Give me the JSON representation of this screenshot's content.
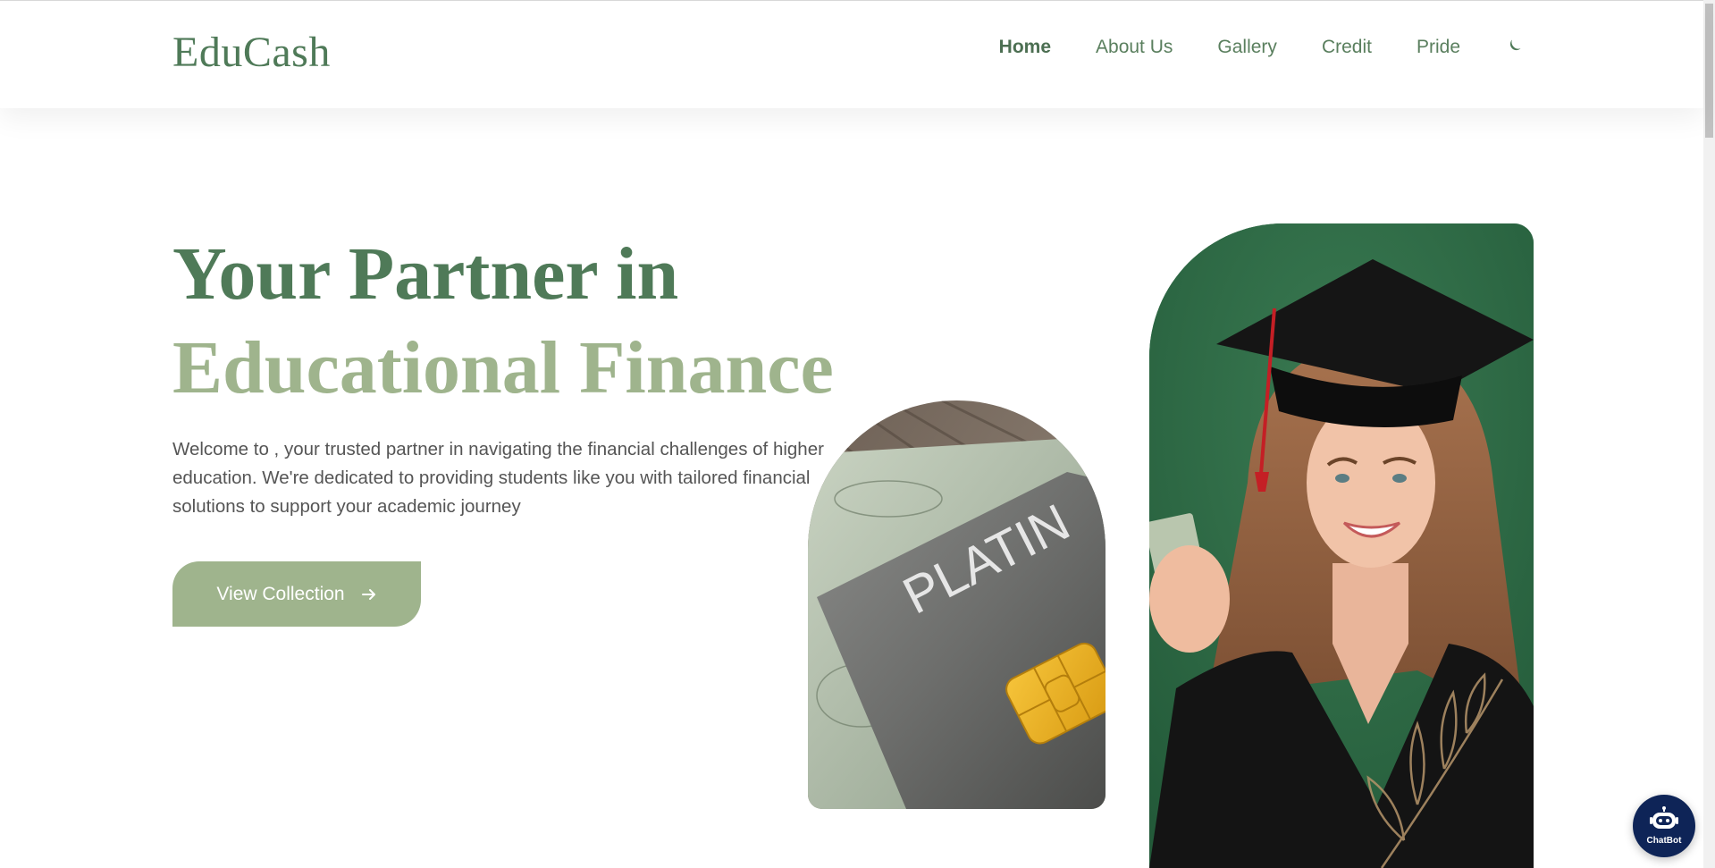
{
  "brand": {
    "name": "EduCash"
  },
  "nav": {
    "items": [
      {
        "label": "Home",
        "active": true
      },
      {
        "label": "About Us",
        "active": false
      },
      {
        "label": "Gallery",
        "active": false
      },
      {
        "label": "Credit",
        "active": false
      },
      {
        "label": "Pride",
        "active": false
      }
    ],
    "theme_toggle_icon": "moon-icon"
  },
  "hero": {
    "title_line1": "Your Partner in",
    "title_line2": "Educational Finance",
    "intro": "Welcome to , your trusted partner in navigating the financial challenges of higher education. We're dedicated to providing students like you with tailored financial solutions to support your academic journey",
    "cta_label": "View Collection",
    "cta_icon": "arrow-right-icon"
  },
  "images": {
    "card_text": "PLATIN",
    "card_icon": "credit-card-image",
    "student_icon": "graduate-student-image"
  },
  "chatbot": {
    "label": "ChatBot",
    "icon": "robot-icon"
  },
  "colors": {
    "primary": "#4f7a58",
    "accent": "#9fb48d",
    "chatbot": "#0e2457"
  }
}
